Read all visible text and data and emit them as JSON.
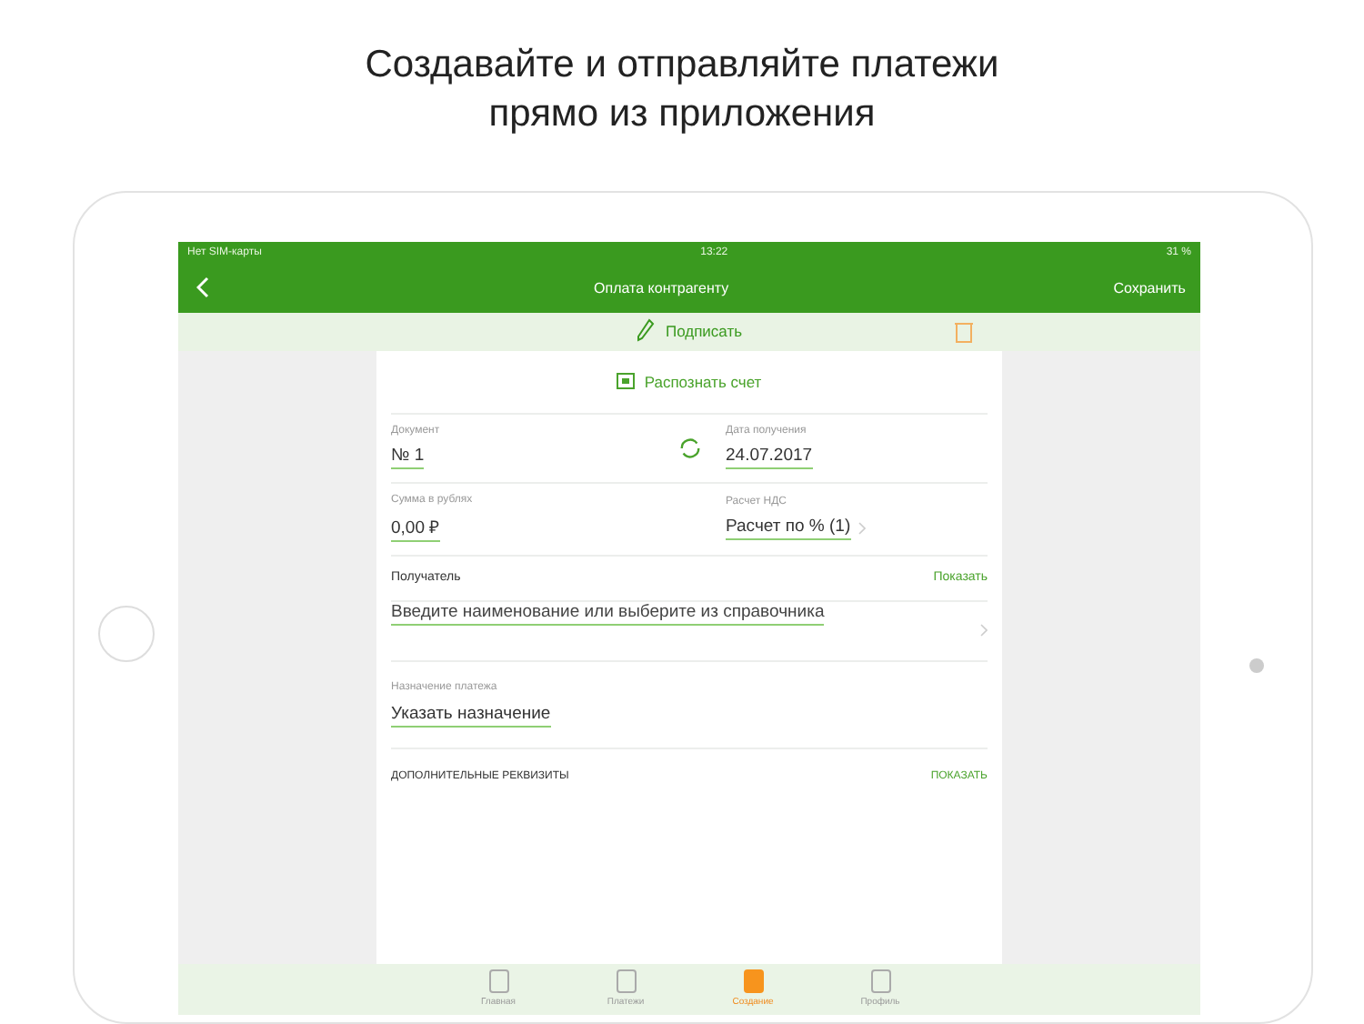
{
  "headline": [
    "Создавайте и отправляйте платежи",
    "прямо из приложения"
  ],
  "status_bar": {
    "carrier": "Нет SIM-карты",
    "time": "13:22",
    "battery": "31 %"
  },
  "nav": {
    "title": "Оплата контрагенту",
    "action": "Сохранить"
  },
  "sign_bar": {
    "label": "Подписать"
  },
  "recognize": {
    "label": "Распознать счет"
  },
  "fields": [
    {
      "label": "Документ",
      "value": "№ 1",
      "chevron": false
    },
    {
      "label": "Дата получения",
      "value": "24.07.2017",
      "chevron": false
    },
    {
      "label": "Сумма в рублях",
      "value": "0,00 ₽",
      "chevron": false
    },
    {
      "label": "Расчет НДС",
      "value": "Расчет по % (1)",
      "chevron": true
    }
  ],
  "recipient": {
    "label": "Получатель",
    "action": "Показать",
    "placeholder": "Введите наименование или выберите из справочника"
  },
  "purpose": {
    "label": "Назначение платежа",
    "value": "Указать назначение"
  },
  "extra": {
    "label": "ДОПОЛНИТЕЛЬНЫЕ РЕКВИЗИТЫ",
    "action": "ПОКАЗАТЬ"
  },
  "tabs": [
    {
      "label": "Главная",
      "selected": false
    },
    {
      "label": "Платежи",
      "selected": false
    },
    {
      "label": "Создание",
      "selected": true
    },
    {
      "label": "Профиль",
      "selected": false
    }
  ]
}
